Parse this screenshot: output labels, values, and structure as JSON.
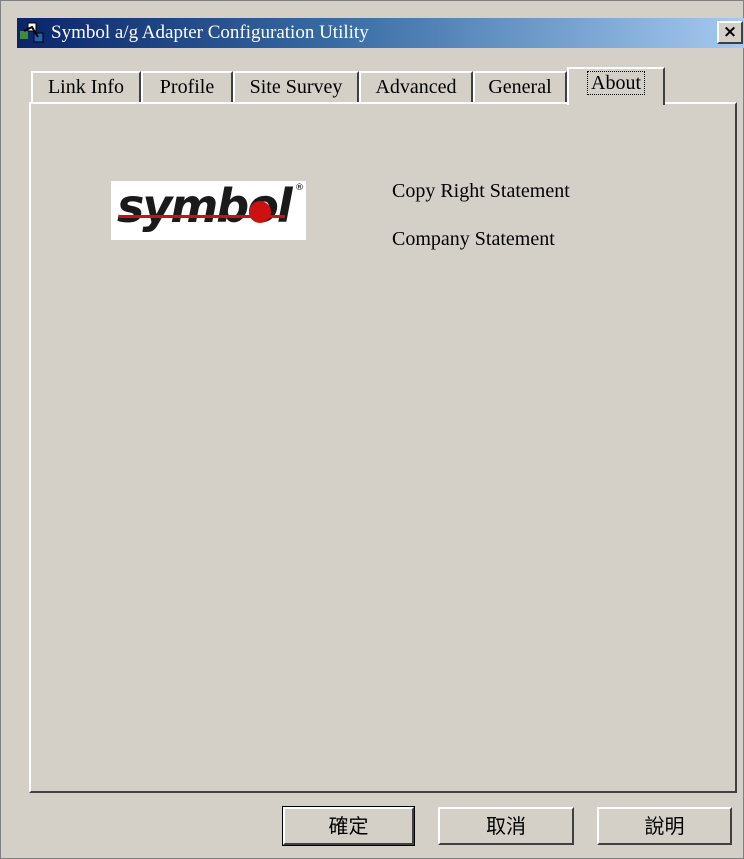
{
  "window": {
    "title": "Symbol a/g Adapter Configuration Utility",
    "close_label": "×"
  },
  "tabs": [
    {
      "label": "Link Info",
      "active": false
    },
    {
      "label": "Profile",
      "active": false
    },
    {
      "label": "Site Survey",
      "active": false
    },
    {
      "label": "Advanced",
      "active": false
    },
    {
      "label": "General",
      "active": false
    },
    {
      "label": "About",
      "active": true
    }
  ],
  "about": {
    "logo_text": "symbol",
    "logo_mark": "®",
    "copyright": "Copy Right Statement",
    "company": "Company Statement"
  },
  "buttons": {
    "ok": "確定",
    "cancel": "取消",
    "help": "說明"
  },
  "colors": {
    "title_gradient_start": "#0a246a",
    "title_gradient_end": "#a6caf0",
    "face": "#d4d0c8",
    "logo_red": "#cc1111"
  },
  "icons": {
    "app": "network-adapter-icon",
    "close": "close-icon"
  }
}
